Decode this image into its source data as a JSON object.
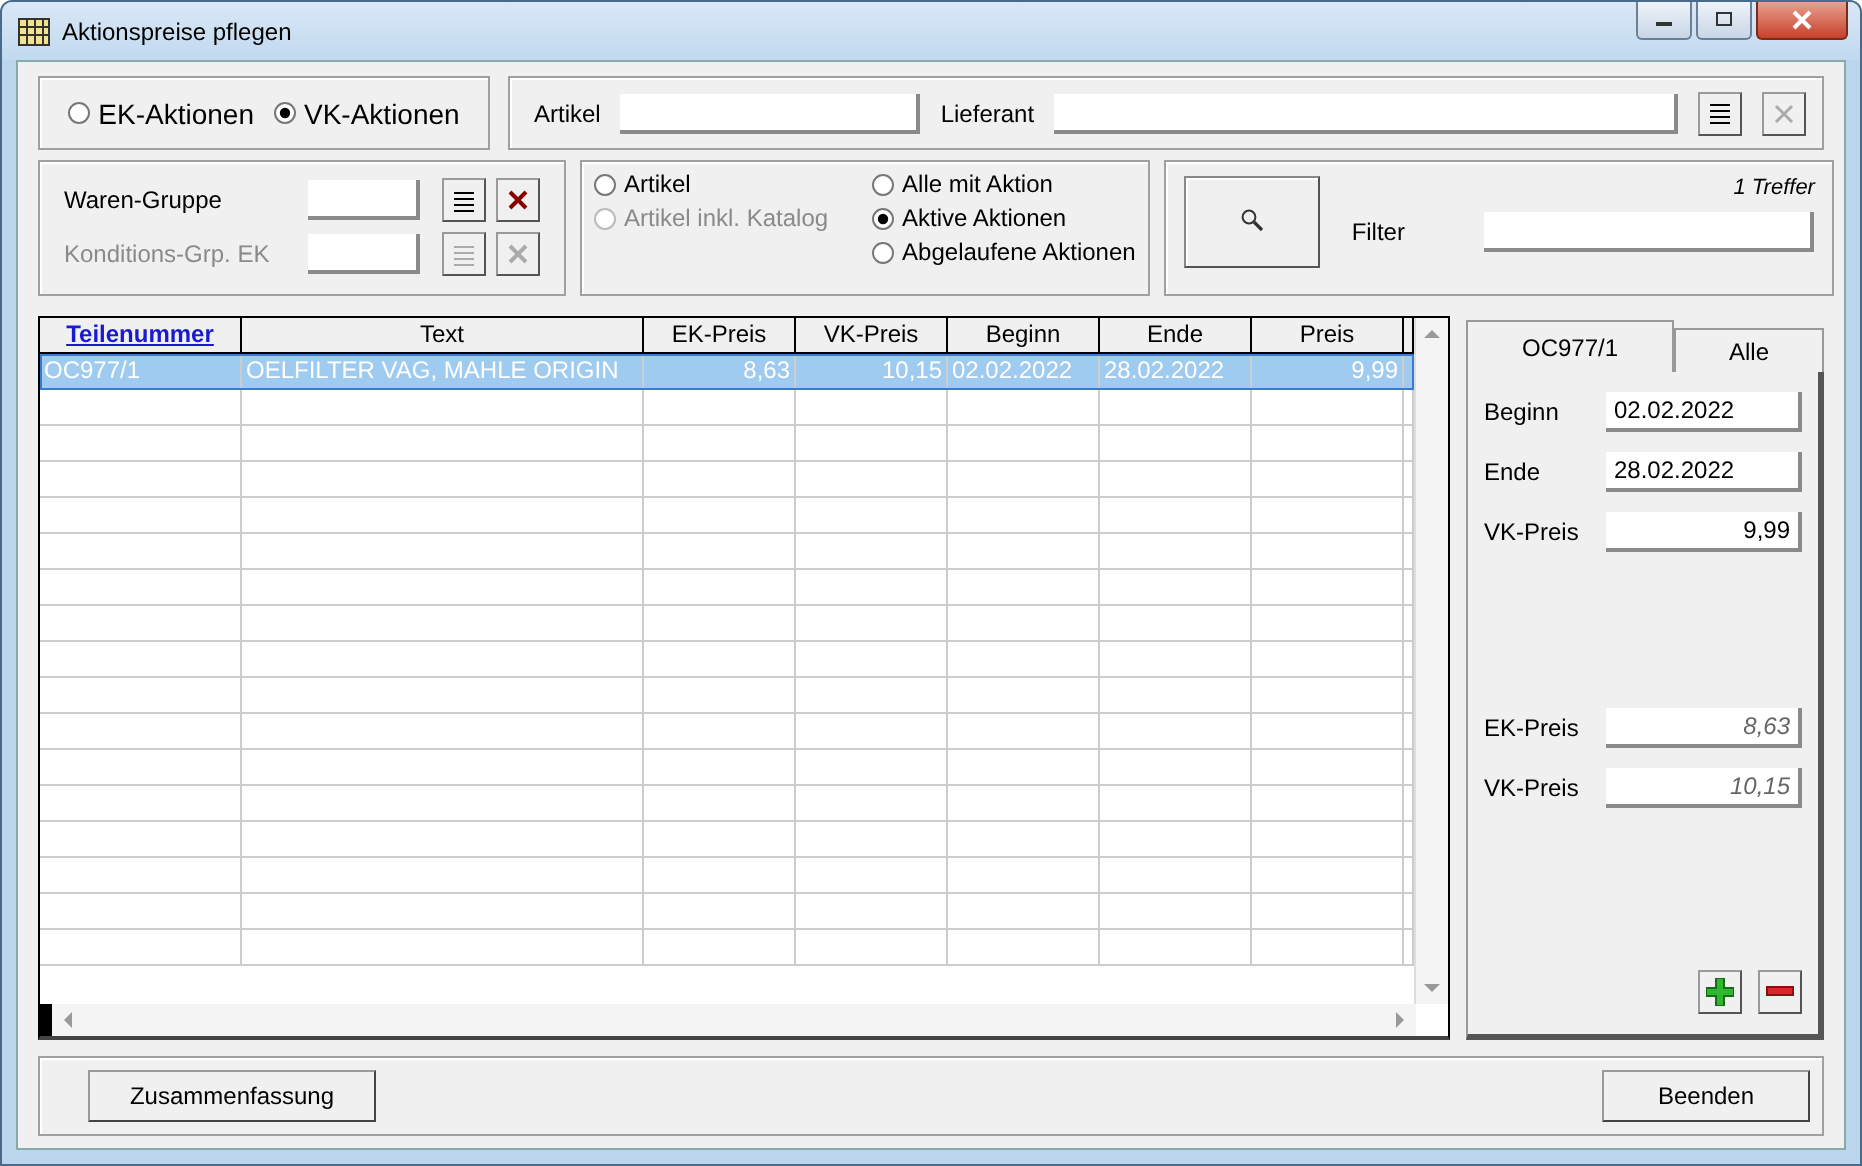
{
  "window": {
    "title": "Aktionspreise pflegen"
  },
  "mode_radios": [
    {
      "label": "EK-Aktionen",
      "selected": false
    },
    {
      "label": "VK-Aktionen",
      "selected": true
    }
  ],
  "artikel_field": {
    "label": "Artikel"
  },
  "lieferant_field": {
    "label": "Lieferant"
  },
  "group_fields": [
    {
      "label": "Waren-Gruppe",
      "disabled": false
    },
    {
      "label": "Konditions-Grp. EK",
      "disabled": true
    }
  ],
  "scope_radios": [
    {
      "label": "Artikel",
      "selected": false,
      "disabled": false
    },
    {
      "label": "Artikel inkl. Katalog",
      "selected": false,
      "disabled": true
    }
  ],
  "status_radios": [
    {
      "label": "Alle mit Aktion",
      "selected": false
    },
    {
      "label": "Aktive Aktionen",
      "selected": true
    },
    {
      "label": "Abgelaufene Aktionen",
      "selected": false
    }
  ],
  "search": {
    "hits": "1 Treffer",
    "filter_label": "Filter"
  },
  "table": {
    "columns": [
      {
        "label": "Teilenummer"
      },
      {
        "label": "Text"
      },
      {
        "label": "EK-Preis"
      },
      {
        "label": "VK-Preis"
      },
      {
        "label": "Beginn"
      },
      {
        "label": "Ende"
      },
      {
        "label": "Preis"
      }
    ],
    "rows": [
      {
        "selected": true,
        "cells": [
          "OC977/1",
          "OELFILTER VAG, MAHLE ORIGIN",
          "8,63",
          "10,15",
          "02.02.2022",
          "28.02.2022",
          "9,99"
        ]
      }
    ]
  },
  "detail": {
    "tabs": [
      {
        "label": "OC977/1",
        "selected": true
      },
      {
        "label": "Alle",
        "selected": false
      }
    ],
    "fields": [
      {
        "label": "Beginn",
        "value": "02.02.2022",
        "disabled": false
      },
      {
        "label": "Ende",
        "value": "28.02.2022",
        "disabled": false
      },
      {
        "label": "VK-Preis",
        "value": "9,99",
        "disabled": false
      }
    ],
    "readonly_fields": [
      {
        "label": "EK-Preis",
        "value": "8,63",
        "disabled": true
      },
      {
        "label": "VK-Preis",
        "value": "10,15",
        "disabled": true
      }
    ]
  },
  "buttons": {
    "summary": "Zusammenfassung",
    "close": "Beenden"
  }
}
